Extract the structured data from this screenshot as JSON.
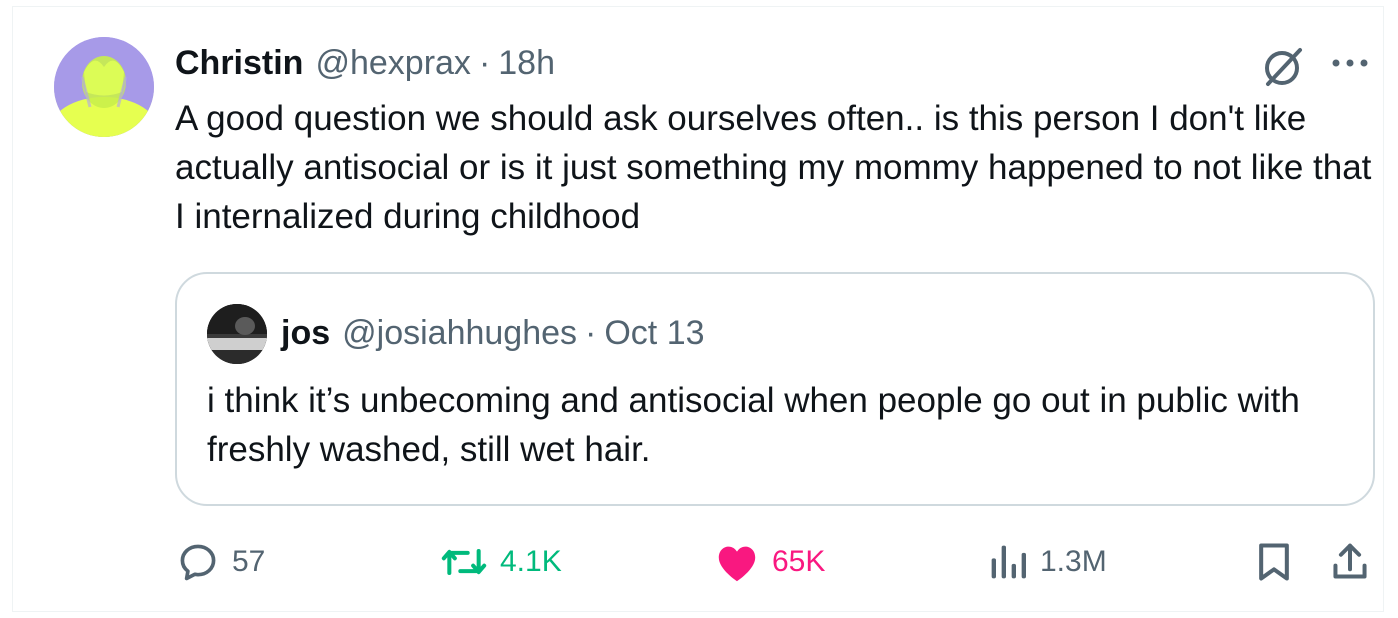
{
  "tweet": {
    "author_name": "Christin",
    "author_handle": "@hexprax",
    "separator": "·",
    "time": "18h",
    "text": "A good question we should ask ourselves often.. is this person I don't like actually antisocial or is it just something my mommy happened to not like that I internalized during childhood"
  },
  "quoted": {
    "author_name": "jos",
    "author_handle": "@josiahhughes",
    "separator": "·",
    "date": "Oct 13",
    "text": "i think it’s unbecoming and antisocial when people go out in public with freshly washed, still wet hair."
  },
  "actions": {
    "replies": "57",
    "retweets": "4.1K",
    "likes": "65K",
    "views": "1.3M"
  },
  "icons": {
    "grok": "grok-icon",
    "more": "more-icon",
    "reply": "reply-icon",
    "retweet": "retweet-icon",
    "like": "heart-icon",
    "views": "views-icon",
    "bookmark": "bookmark-icon",
    "share": "share-icon"
  },
  "colors": {
    "text": "#0f1419",
    "secondary": "#536471",
    "retweet": "#00ba7c",
    "like": "#f91880",
    "border": "#cfd9de"
  }
}
